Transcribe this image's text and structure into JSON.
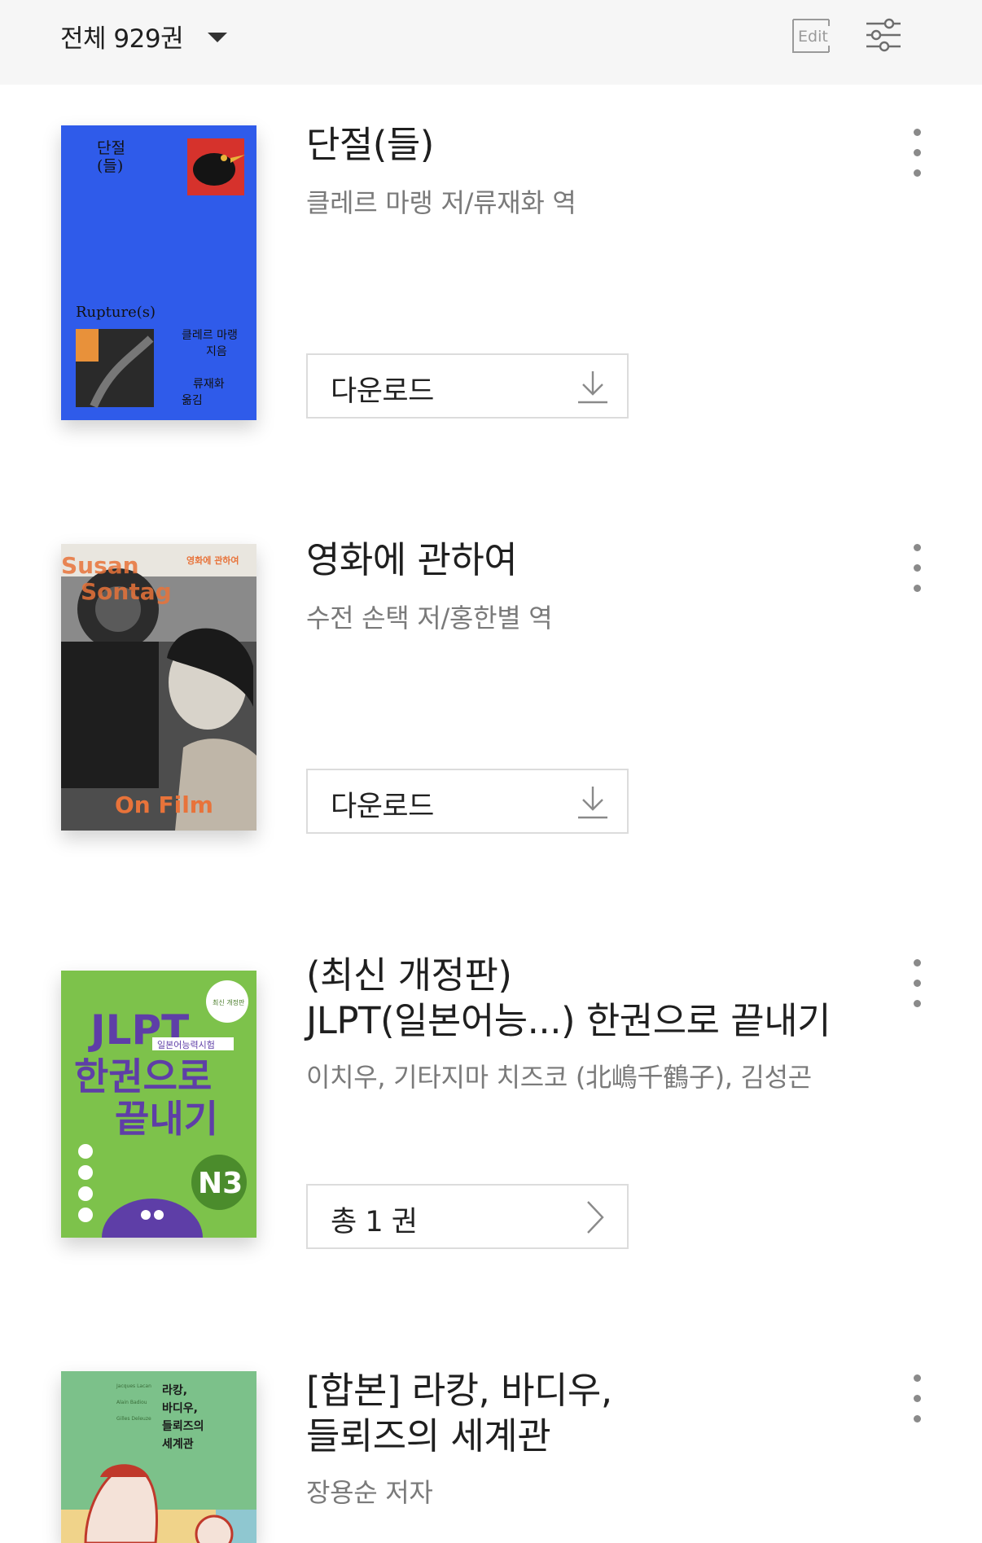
{
  "header": {
    "title": "전체 929권",
    "edit_label": "Edit"
  },
  "books": [
    {
      "title": "단절(들)",
      "author": "클레르 마랭 저/류재화 역",
      "action_label": "다운로드",
      "action_icon": "download-icon",
      "cover": {
        "bg": "#2f5bea",
        "title": "단절\n(들)",
        "subtitle": "Rupture(s)",
        "author_line1": "클레르 마랭",
        "author_line2": "지음",
        "translator_line1": "류재화",
        "translator_line2": "옮김"
      }
    },
    {
      "title": "영화에 관하여",
      "author": "수전 손택 저/홍한별 역",
      "action_label": "다운로드",
      "action_icon": "download-icon",
      "cover": {
        "bg": "#e9e6df",
        "header": "영화에 관하여",
        "name1": "Susan",
        "name2": "Sontag",
        "subtitle": "On Film",
        "accent": "#e8733a"
      }
    },
    {
      "title": "(최신 개정판)\nJLPT(일본어능...) 한권으로 끝내기",
      "author": "이치우, 기타지마 치즈코 (北嶋千鶴子), 김성곤",
      "action_label": "총 1 권",
      "action_icon": "chevron-right-icon",
      "cover": {
        "bg": "#7dc24b",
        "line1": "JLPT",
        "line2": "한권으로",
        "line3": "끝내기",
        "badge_label": "최신 개정판",
        "ribbon": "일본어능력시험",
        "level": "N3",
        "accent": "#5e3ea7"
      }
    },
    {
      "title": "[합본] 라캉, 바디우,\n들뢰즈의 세계관",
      "author": "장용순 저자",
      "cover": {
        "bg": "#7cc18a",
        "title_line1": "라캉,",
        "title_line2": "바디우,",
        "title_line3": "들뢰즈의",
        "title_line4": "세계관",
        "name1": "Jacques Lacan",
        "name2": "Alain Badiou",
        "name3": "Gilles Deleuze"
      }
    }
  ]
}
